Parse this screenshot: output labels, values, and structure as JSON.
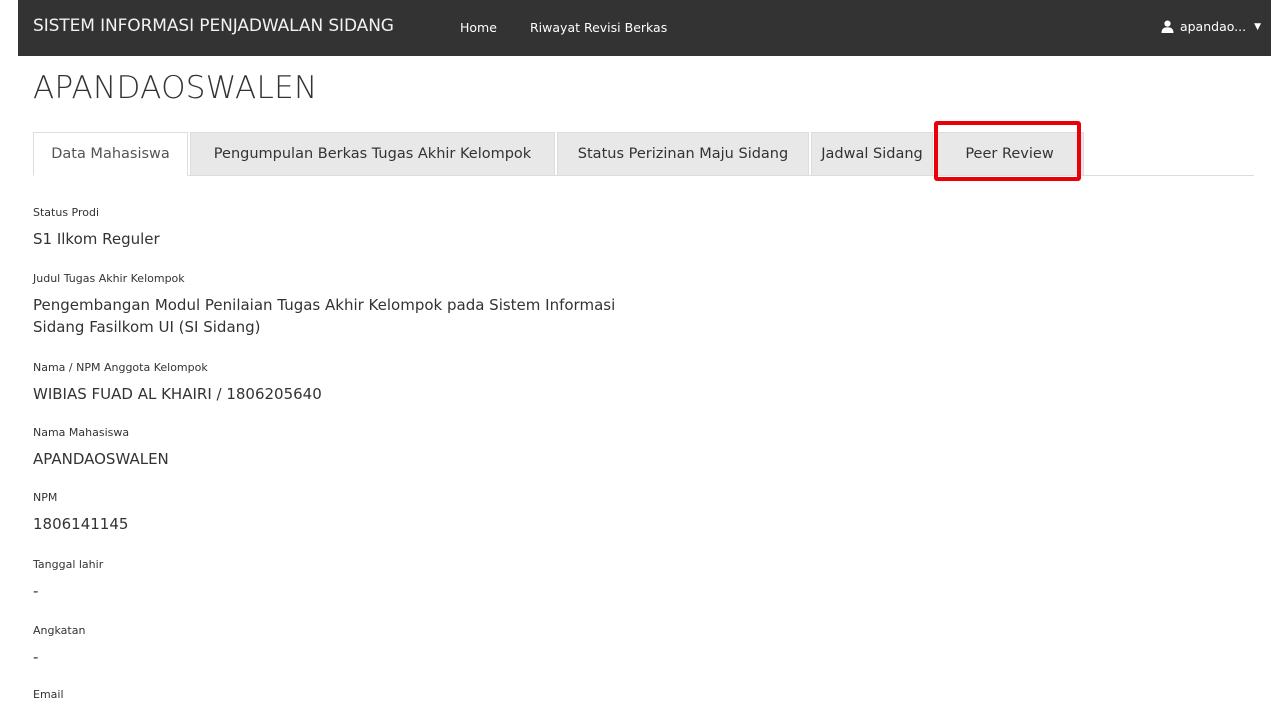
{
  "navbar": {
    "brand": "SISTEM INFORMASI PENJADWALAN SIDANG",
    "links": [
      "Home",
      "Riwayat Revisi Berkas"
    ],
    "user": "apandao..."
  },
  "page_title": "APANDAOSWALEN",
  "tabs": [
    {
      "label": "Data Mahasiswa",
      "active": true
    },
    {
      "label": "Pengumpulan Berkas Tugas Akhir Kelompok",
      "active": false
    },
    {
      "label": "Status Perizinan Maju Sidang",
      "active": false
    },
    {
      "label": "Jadwal Sidang",
      "active": false
    },
    {
      "label": "Peer Review",
      "active": false,
      "highlighted": true
    }
  ],
  "fields": [
    {
      "label": "Status Prodi",
      "value": "S1 Ilkom Reguler"
    },
    {
      "label": "Judul Tugas Akhir Kelompok",
      "value": "Pengembangan Modul Penilaian Tugas Akhir Kelompok pada Sistem Informasi Sidang Fasilkom UI (SI Sidang)"
    },
    {
      "label": "Nama / NPM Anggota Kelompok",
      "value": "WIBIAS FUAD AL KHAIRI / 1806205640"
    },
    {
      "label": "Nama Mahasiswa",
      "value": "APANDAOSWALEN"
    },
    {
      "label": "NPM",
      "value": "1806141145"
    },
    {
      "label": "Tanggal lahir",
      "value": "-"
    },
    {
      "label": "Angkatan",
      "value": "-"
    },
    {
      "label": "Email",
      "value": ""
    }
  ],
  "colors": {
    "navbar_bg": "#333333",
    "highlight": "#e8000b",
    "tab_inactive_bg": "#e8e8e8"
  }
}
